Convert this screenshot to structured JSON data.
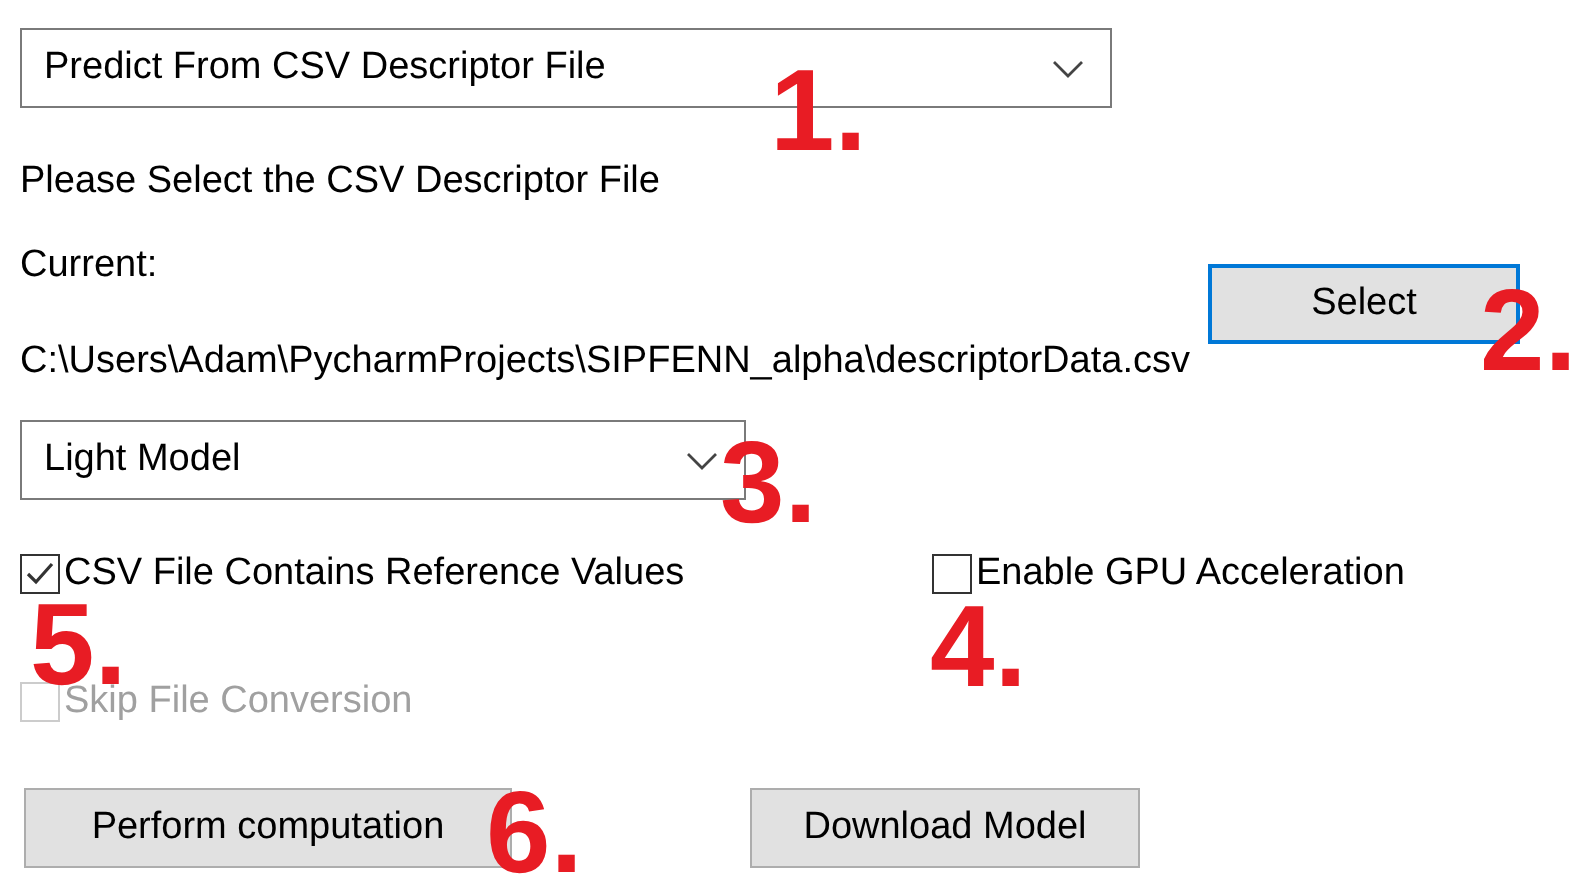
{
  "mode_dropdown": {
    "value": "Predict From CSV Descriptor File"
  },
  "instruction": "Please Select the CSV Descriptor File",
  "current_label": "Current:",
  "select_button": {
    "label": "Select",
    "focused": true
  },
  "current_path": "C:\\Users\\Adam\\PycharmProjects\\SIPFENN_alpha\\descriptorData.csv",
  "model_dropdown": {
    "value": "Light Model"
  },
  "checkboxes": [
    {
      "label": "CSV File Contains Reference Values",
      "checked": true,
      "disabled": false
    },
    {
      "label": "Enable GPU Acceleration",
      "checked": false,
      "disabled": false
    },
    {
      "label": "Skip File Conversion",
      "checked": false,
      "disabled": true
    }
  ],
  "buttons": [
    {
      "label": "Perform computation"
    },
    {
      "label": "Download Model"
    }
  ],
  "annotations": [
    {
      "label": "1."
    },
    {
      "label": "2."
    },
    {
      "label": "3."
    },
    {
      "label": "4."
    },
    {
      "label": "5."
    },
    {
      "label": "6."
    }
  ]
}
